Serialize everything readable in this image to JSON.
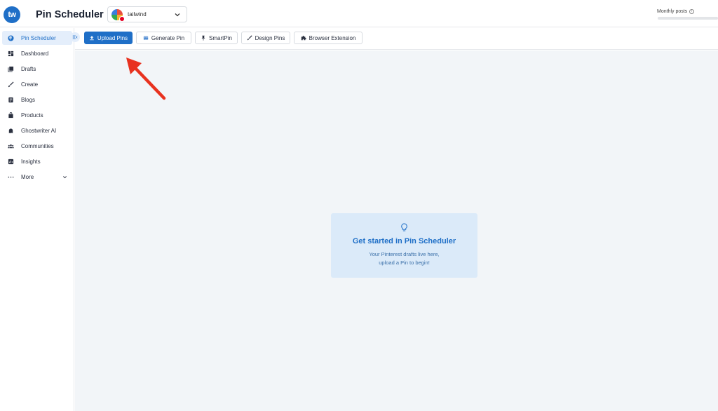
{
  "header": {
    "logo_text": "tw",
    "app_title": "Pin Scheduler",
    "account": {
      "name": "tailwind"
    },
    "monthly_posts": {
      "label": "Monthly posts",
      "used_fraction": 0.0
    }
  },
  "sidebar": {
    "items": [
      {
        "label": "Pin Scheduler",
        "icon": "pinterest-icon",
        "active": true
      },
      {
        "label": "Dashboard",
        "icon": "dashboard-icon"
      },
      {
        "label": "Drafts",
        "icon": "drafts-icon"
      },
      {
        "label": "Create",
        "icon": "brush-icon"
      },
      {
        "label": "Blogs",
        "icon": "blog-icon"
      },
      {
        "label": "Products",
        "icon": "shopping-bag-icon"
      },
      {
        "label": "Ghostwriter AI",
        "icon": "ghost-icon"
      },
      {
        "label": "Communities",
        "icon": "communities-icon"
      },
      {
        "label": "Insights",
        "icon": "chart-icon"
      },
      {
        "label": "More",
        "icon": "more-dots-icon"
      }
    ]
  },
  "toolbar": {
    "upload_pins": "Upload Pins",
    "generate_pin": "Generate Pin",
    "smartpin": "SmartPin",
    "design_pins": "Design Pins",
    "browser_extension": "Browser Extension"
  },
  "empty_state": {
    "title": "Get started in Pin Scheduler",
    "line1": "Your Pinterest drafts live here,",
    "line2": "upload a Pin to begin!"
  },
  "colors": {
    "accent": "#1f6fc7",
    "arrow": "#e8321f",
    "main_bg": "#f2f5f8",
    "card_bg": "#dbeaf9"
  }
}
